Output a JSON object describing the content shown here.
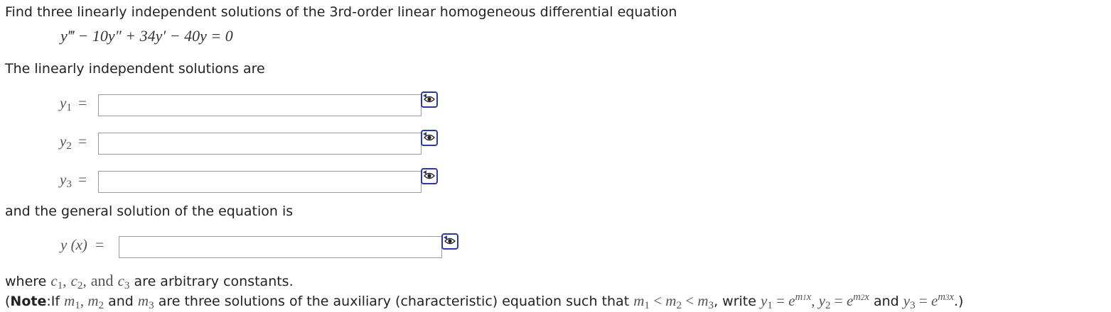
{
  "problem": {
    "prompt": "Find three linearly independent solutions of the 3rd-order linear homogeneous differential equation",
    "equation": {
      "t1": "y‴",
      "t2": "− 10y″",
      "t3": "+ 34y′",
      "t4": "− 40y",
      "t5": "= 0"
    },
    "solutions_intro": "The linearly independent solutions are",
    "fields": [
      {
        "var": "y",
        "sub": "1",
        "eq": "=",
        "value": ""
      },
      {
        "var": "y",
        "sub": "2",
        "eq": "=",
        "value": ""
      },
      {
        "var": "y",
        "sub": "3",
        "eq": "=",
        "value": ""
      }
    ],
    "general_intro": "and the general solution of the equation is",
    "general_field": {
      "lhs": "y (x)",
      "eq": "=",
      "value": ""
    },
    "constants_note": {
      "prefix": "where",
      "c1": "c",
      "c1sub": "1",
      "sep1": ",",
      "c2": "c",
      "c2sub": "2",
      "sep2": ",",
      "and": "and",
      "c3": "c",
      "c3sub": "3",
      "suffix": "are arbitrary constants."
    },
    "note": {
      "open": "(",
      "bold": "Note",
      "lead": ":If",
      "m": "m",
      "s1": "1",
      "s2": "2",
      "s3": "3",
      "comma": ",",
      "and": "and",
      "mid": "are three solutions of the auxiliary (characteristic) equation such that",
      "lt": "<",
      "write": ", write",
      "y": "y",
      "eq": "=",
      "e": "e",
      "x": "x",
      "close": ".)"
    }
  },
  "icons": {
    "preview": "eye-preview-icon"
  },
  "colors": {
    "accent": "#2b3aa0",
    "border": "#9a9a9a",
    "text": "#222222"
  }
}
